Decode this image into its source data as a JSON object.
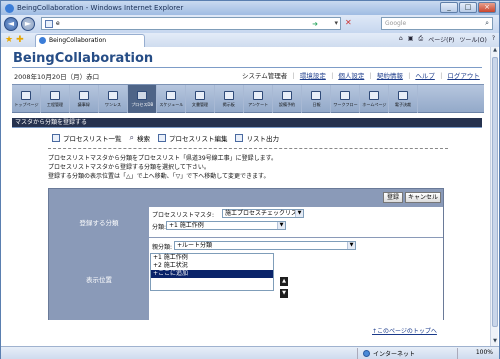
{
  "window": {
    "title": "BeingCollaboration - Windows Internet Explorer",
    "minimize": "_",
    "maximize": "□",
    "close": "×"
  },
  "addressbar": {
    "url": "e",
    "search_placeholder": "Google"
  },
  "tabs": {
    "active_label": "BeingCollaboration"
  },
  "toolbar": {
    "home": "⌂",
    "feeds": "▣",
    "print": "⎙",
    "page": "ページ(P)",
    "tools": "ツール(O)",
    "help": "?"
  },
  "site": {
    "title": "BeingCollaboration",
    "date": "2008年10月20日（月）赤口"
  },
  "toplinks": {
    "admin": "システム管理者",
    "sep": "｜",
    "env": "環境設定",
    "personal": "個人設定",
    "info": "契約情報",
    "help": "ヘルプ",
    "logout": "ログアウト"
  },
  "menu": [
    {
      "label": "トップページ",
      "icon": "home-icon"
    },
    {
      "label": "工程管理",
      "icon": "process-icon"
    },
    {
      "label": "議事録",
      "icon": "minutes-icon"
    },
    {
      "label": "ワンレス",
      "icon": "mail-icon"
    },
    {
      "label": "プロセスDB",
      "icon": "database-icon"
    },
    {
      "label": "スケジュール",
      "icon": "calendar-icon"
    },
    {
      "label": "文書管理",
      "icon": "folder-icon"
    },
    {
      "label": "掲示板",
      "icon": "board-icon"
    },
    {
      "label": "アンケート",
      "icon": "survey-icon"
    },
    {
      "label": "設備予約",
      "icon": "reserve-icon"
    },
    {
      "label": "日報",
      "icon": "report-icon"
    },
    {
      "label": "ワークフロー",
      "icon": "workflow-icon"
    },
    {
      "label": "ホームページ",
      "icon": "web-icon"
    },
    {
      "label": "電子決裁",
      "icon": "approval-icon"
    }
  ],
  "section": {
    "title": "マスタから分類を登録する"
  },
  "subnav": {
    "list": "プロセスリスト一覧",
    "search": "検索",
    "edit": "プロセスリスト編集",
    "output": "リスト出力"
  },
  "description": [
    "プロセスリストマスタから分類をプロセスリスト「県道39号線工事」に登録します。",
    "プロセスリストマスタから登録する分類を選択して下さい。",
    "登録する分類の表示位置は「△」で上へ移動、「▽」で下へ移動して変更できます。"
  ],
  "form": {
    "register_btn": "登録",
    "cancel_btn": "キャンセル",
    "category_label": "登録する分類",
    "position_label": "表示位置",
    "master_label": "プロセスリストマスタ:",
    "master_value": "施工プロセスチェックリスト",
    "category_field_label": "分類:",
    "category_value": "+1 施工作例",
    "parent_label": "親分類:",
    "parent_value": "+ルート分類",
    "list_items": [
      "+1 施工作例",
      "+2 施工状況",
      "+ここに追加"
    ],
    "up": "▲",
    "down": "▼"
  },
  "backlink": "↑このページのトップへ",
  "status": {
    "zone": "インターネット",
    "zoom": "100%"
  }
}
